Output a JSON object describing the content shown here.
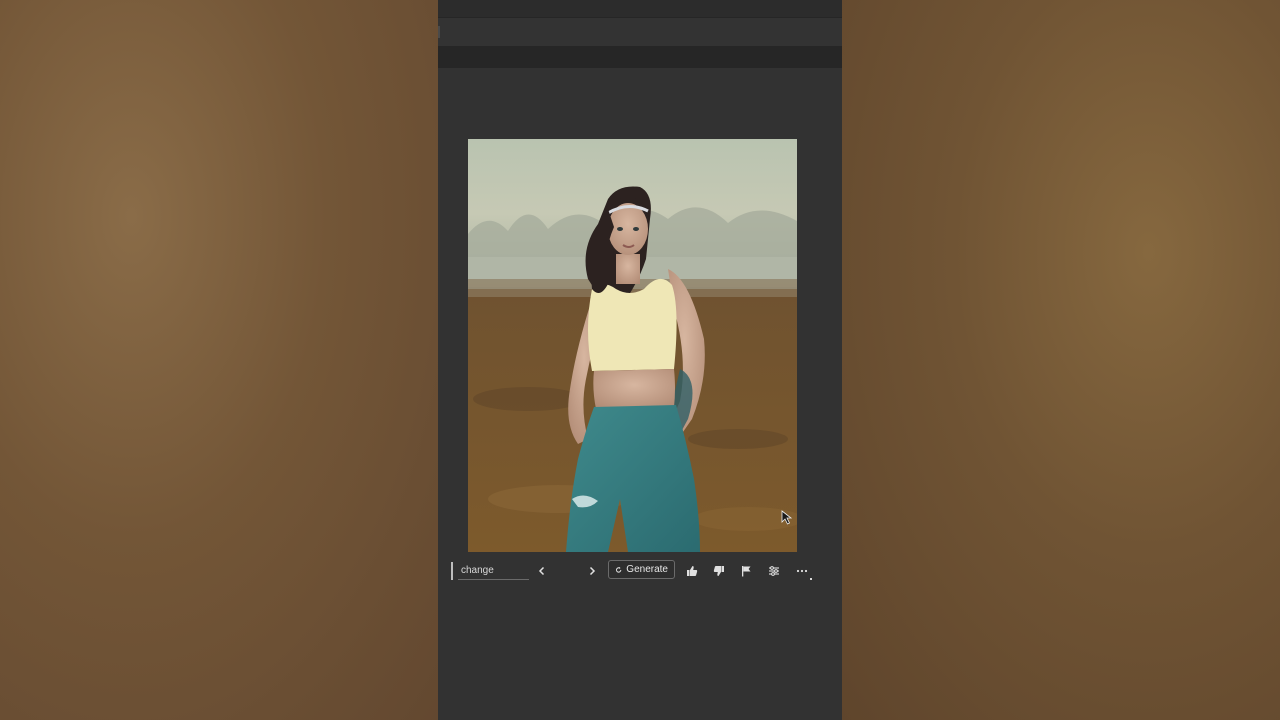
{
  "prompt": {
    "value": "change"
  },
  "toolbar": {
    "generate_label": "Generate",
    "previous_icon": "chevron-left-icon",
    "next_icon": "chevron-right-icon",
    "refresh_icon": "refresh-icon",
    "like_icon": "thumbs-up-icon",
    "dislike_icon": "thumbs-down-icon",
    "report_icon": "flag-icon",
    "options_icon": "sliders-icon",
    "more_icon": "more-horizontal-icon"
  },
  "colors": {
    "app_bg": "#323232",
    "backdrop": "#6a4e31",
    "text": "#e8e8e8"
  }
}
